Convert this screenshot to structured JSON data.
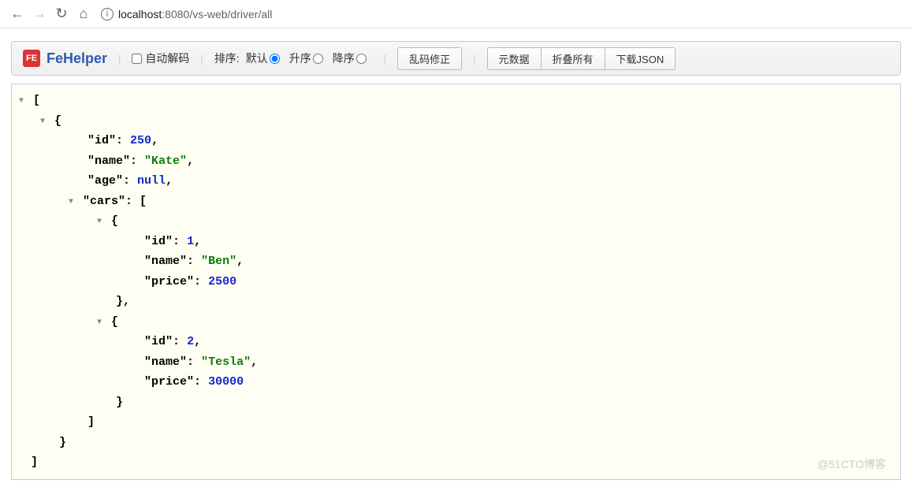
{
  "browser": {
    "url_host": "localhost",
    "url_port": ":8080",
    "url_path": "/vs-web/driver/all"
  },
  "toolbar": {
    "brand": "FeHelper",
    "brand_logo": "FE",
    "auto_decode": "自动解码",
    "sort_label": "排序:",
    "sort_default": "默认",
    "sort_asc": "升序",
    "sort_desc": "降序",
    "btn_fix": "乱码修正",
    "btn_raw": "元数据",
    "btn_collapse": "折叠所有",
    "btn_download": "下载JSON"
  },
  "json": {
    "obj0_id_key": "\"id\"",
    "obj0_id_val": "250",
    "obj0_name_key": "\"name\"",
    "obj0_name_val": "\"Kate\"",
    "obj0_age_key": "\"age\"",
    "obj0_age_val": "null",
    "obj0_cars_key": "\"cars\"",
    "car0_id_key": "\"id\"",
    "car0_id_val": "1",
    "car0_name_key": "\"name\"",
    "car0_name_val": "\"Ben\"",
    "car0_price_key": "\"price\"",
    "car0_price_val": "2500",
    "car1_id_key": "\"id\"",
    "car1_id_val": "2",
    "car1_name_key": "\"name\"",
    "car1_name_val": "\"Tesla\"",
    "car1_price_key": "\"price\"",
    "car1_price_val": "30000"
  },
  "watermark": "@51CTO博客"
}
